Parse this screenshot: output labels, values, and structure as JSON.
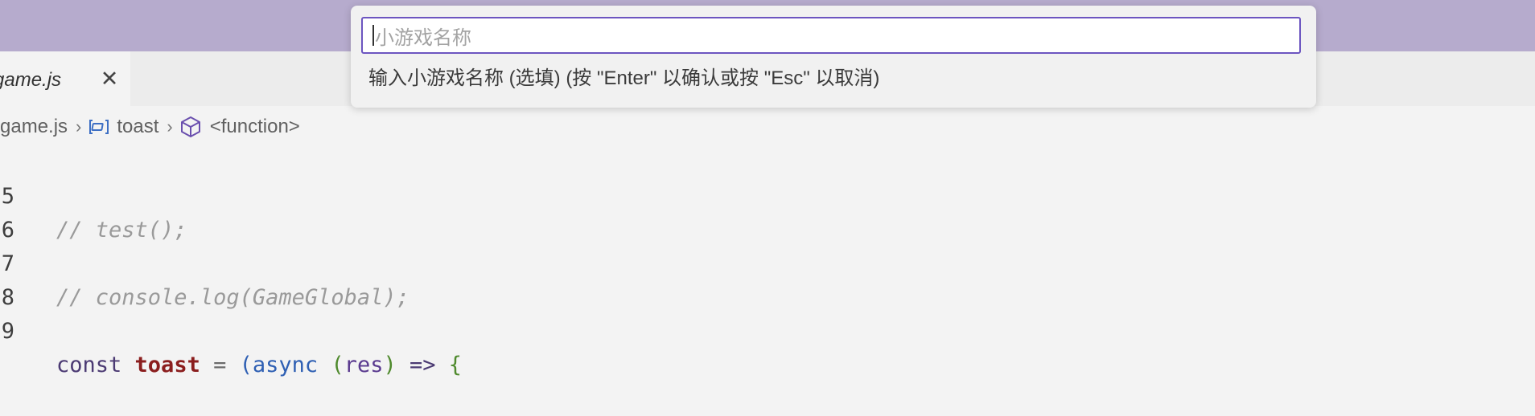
{
  "tab": {
    "label": "game.js",
    "close_glyph": "✕"
  },
  "breadcrumb": {
    "items": [
      {
        "label": "game.js",
        "icon": ""
      },
      {
        "label": "toast",
        "icon": "symbol-variable-icon"
      },
      {
        "label": "<function>",
        "icon": "symbol-method-cube-icon"
      }
    ],
    "separator": "›"
  },
  "quick_input": {
    "placeholder": "小游戏名称",
    "message": "输入小游戏名称 (选填) (按 \"Enter\" 以确认或按 \"Esc\" 以取消)"
  },
  "editor": {
    "lines": [
      {
        "number": "5",
        "text": "// test();"
      },
      {
        "number": "6",
        "text": ""
      },
      {
        "number": "7",
        "text": "// console.log(GameGlobal);"
      },
      {
        "number": "8",
        "text": ""
      },
      {
        "number": "9",
        "tokens": [
          "const",
          "toast",
          "=",
          "(",
          "async",
          "(",
          "res",
          ")",
          "=>",
          "{"
        ]
      }
    ]
  },
  "colors": {
    "title_bar": "#b6abcd",
    "input_border": "#6c55c0",
    "editor_bg": "#f3f3f3"
  }
}
